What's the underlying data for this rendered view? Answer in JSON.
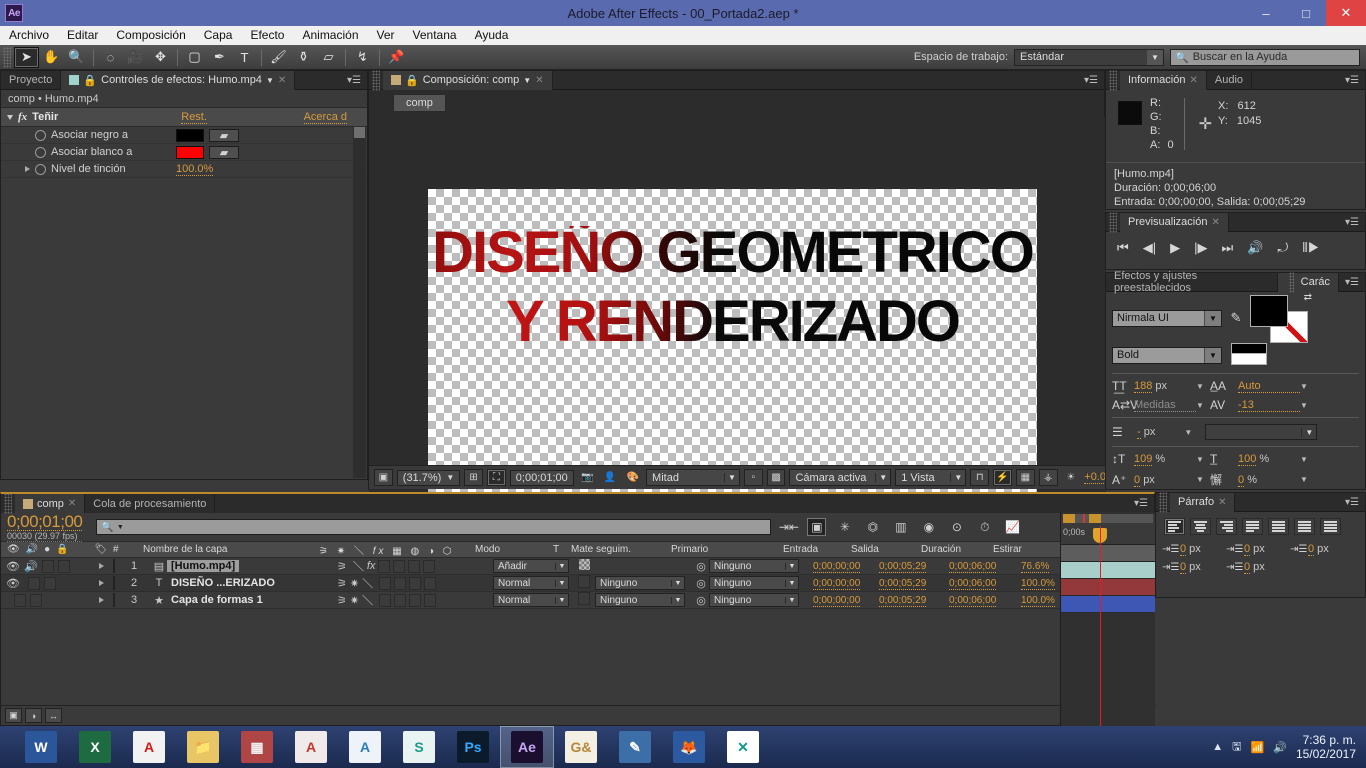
{
  "window": {
    "title": "Adobe After Effects - 00_Portada2.aep *",
    "logo": "Ae",
    "minimize": "–",
    "maximize": "□",
    "close": "✕"
  },
  "menu": [
    "Archivo",
    "Editar",
    "Composición",
    "Capa",
    "Efecto",
    "Animación",
    "Ver",
    "Ventana",
    "Ayuda"
  ],
  "toolbar": {
    "workspace_label": "Espacio de trabajo:",
    "workspace_value": "Estándar",
    "help_search_placeholder": "Buscar en la Ayuda",
    "tools": [
      {
        "name": "selection-tool",
        "glyph": "➤"
      },
      {
        "name": "hand-tool",
        "glyph": "✋"
      },
      {
        "name": "zoom-tool",
        "glyph": "🔍"
      },
      {
        "name": "rotation-tool",
        "glyph": "◌"
      },
      {
        "name": "camera-tool",
        "glyph": "🎥"
      },
      {
        "name": "pan-behind-tool",
        "glyph": "✥"
      },
      {
        "name": "shape-tool",
        "glyph": "▢"
      },
      {
        "name": "pen-tool",
        "glyph": "✒"
      },
      {
        "name": "type-tool",
        "glyph": "T"
      },
      {
        "name": "brush-tool",
        "glyph": "🖌"
      },
      {
        "name": "clone-stamp-tool",
        "glyph": "⚱"
      },
      {
        "name": "eraser-tool",
        "glyph": "▱"
      },
      {
        "name": "roto-brush-tool",
        "glyph": "↯"
      },
      {
        "name": "puppet-pin-tool",
        "glyph": "📌"
      }
    ]
  },
  "effects_panel": {
    "tab_project": "Proyecto",
    "tab_active": "Controles de efectos: Humo.mp4",
    "breadcrumb": "comp • Humo.mp4",
    "effect_name": "Teñir",
    "reset_label": "Rest.",
    "about_label": "Acerca d",
    "properties": [
      {
        "label": "Asociar negro a",
        "color": "#000000",
        "type": "color"
      },
      {
        "label": "Asociar blanco a",
        "color": "#ff0000",
        "type": "color"
      },
      {
        "label": "Nivel de tinción",
        "value": "100.0%",
        "type": "value"
      }
    ]
  },
  "composition": {
    "tab_title": "Composición: comp",
    "sub_tab": "comp",
    "text_line1": "DISEÑO GEOMETRICO",
    "text_line2": "Y RENDERIZADO",
    "toolbar": {
      "zoom": "(31.7%)",
      "timecode": "0;00;01;00",
      "resolution": "Mitad",
      "view_camera": "Cámara activa",
      "views": "1 Vista",
      "exposure": "+0.0"
    }
  },
  "info_panel": {
    "tab_info": "Información",
    "tab_audio": "Audio",
    "r_label": "R:",
    "g_label": "G:",
    "b_label": "B:",
    "a_label": "A:",
    "a_value": "0",
    "x_label": "X:",
    "x_value": "612",
    "y_label": "Y:",
    "y_value": "1045",
    "file_name": "[Humo.mp4]",
    "duration": "Duración: 0;00;06;00",
    "in_out": "Entrada: 0;00;00;00, Salida: 0;00;05;29",
    "swatch_color": "#0b0b0b"
  },
  "preview_panel": {
    "tab": "Previsualización",
    "buttons": [
      {
        "name": "go-to-start-button",
        "glyph": "⏮"
      },
      {
        "name": "previous-frame-button",
        "glyph": "◀|"
      },
      {
        "name": "play-button",
        "glyph": "▶"
      },
      {
        "name": "next-frame-button",
        "glyph": "|▶"
      },
      {
        "name": "go-to-end-button",
        "glyph": "⏭"
      },
      {
        "name": "audio-toggle-button",
        "glyph": "🔊"
      },
      {
        "name": "loop-button",
        "glyph": "⤾"
      },
      {
        "name": "ram-preview-button",
        "glyph": "⦀▶"
      }
    ]
  },
  "character_panel": {
    "tab_effects_presets": "Efectos y ajustes preestablecidos",
    "tab_character": "Carác",
    "font_family": "Nirmala UI",
    "font_style": "Bold",
    "font_size": "188",
    "font_size_unit": "px",
    "leading": "Auto",
    "kerning": "Medidas",
    "tracking": "-13",
    "stroke_width": "-",
    "stroke_width_unit": "px",
    "vertical_scale": "109",
    "vertical_scale_unit": "%",
    "horizontal_scale": "100",
    "horizontal_scale_unit": "%",
    "baseline_shift": "0",
    "baseline_shift_unit": "px",
    "tsume": "0",
    "tsume_unit": "%",
    "fill_color": "#000000",
    "stroke_color": "#ffffff"
  },
  "paragraph_panel": {
    "tab": "Párrafo",
    "indents": [
      {
        "name": "indent-left-margin",
        "value": "0",
        "unit": "px"
      },
      {
        "name": "indent-right-margin",
        "value": "0",
        "unit": "px"
      },
      {
        "name": "indent-first-line",
        "value": "0",
        "unit": "px"
      },
      {
        "name": "space-before-paragraph",
        "value": "0",
        "unit": "px"
      },
      {
        "name": "space-after-paragraph",
        "value": "0",
        "unit": "px"
      }
    ]
  },
  "timeline": {
    "tab_comp": "comp",
    "tab_render_queue": "Cola de procesamiento",
    "current_time": "0;00;01;00",
    "frame_info": "00030 (29.97 fps)",
    "search_placeholder": "",
    "ruler_start": "0;00s",
    "columns": [
      "#",
      "Nombre de la capa",
      "Modo",
      "T",
      "Mate seguim.",
      "Primario",
      "Entrada",
      "Salida",
      "Duración",
      "Estirar"
    ],
    "layers": [
      {
        "index": "1",
        "name": "[Humo.mp4]",
        "color": "#9fd3ce",
        "type_icon": "video-layer-icon",
        "mode": "Añadir",
        "track_matte": "",
        "parent": "Ninguno",
        "in": "0;00;00;00",
        "out": "0;00;05;29",
        "duration": "0;00;06;00",
        "stretch": "76.6%",
        "bar_color": "#a8cfc9",
        "has_fx": true,
        "selected": true
      },
      {
        "index": "2",
        "name": "DISEÑO ...ERIZADO",
        "color": "#b84040",
        "type_icon": "text-layer-icon",
        "mode": "Normal",
        "track_matte": "Ninguno",
        "parent": "Ninguno",
        "in": "0;00;00;00",
        "out": "0;00;05;29",
        "duration": "0;00;06;00",
        "stretch": "100.0%",
        "bar_color": "#94393b",
        "has_fx": false,
        "selected": false
      },
      {
        "index": "3",
        "name": "Capa de formas 1",
        "color": "#4f62c4",
        "type_icon": "shape-layer-icon",
        "mode": "Normal",
        "track_matte": "Ninguno",
        "parent": "Ninguno",
        "in": "0;00;00;00",
        "out": "0;00;05;29",
        "duration": "0;00;06;00",
        "stretch": "100.0%",
        "bar_color": "#3e56b4",
        "has_fx": false,
        "selected": false
      }
    ]
  },
  "taskbar": {
    "apps": [
      {
        "name": "word",
        "label": "W",
        "bg": "#2b579a",
        "fg": "#ffffff"
      },
      {
        "name": "excel",
        "label": "X",
        "bg": "#1e6b41",
        "fg": "#ffffff"
      },
      {
        "name": "acrobat-reader",
        "label": "A",
        "bg": "#f2f2f2",
        "fg": "#d01b1b"
      },
      {
        "name": "file-explorer",
        "label": "📁",
        "bg": "#e8c666",
        "fg": "#6a4b10"
      },
      {
        "name": "civil-3d",
        "label": "▦",
        "bg": "#b04545",
        "fg": "#f0f0f0"
      },
      {
        "name": "autocad",
        "label": "A",
        "bg": "#f0eaea",
        "fg": "#c0392b"
      },
      {
        "name": "autocad-c3d",
        "label": "A",
        "bg": "#edf3f8",
        "fg": "#2b7cc0"
      },
      {
        "name": "arcmap-mxd",
        "label": "S",
        "bg": "#e9f4f2",
        "fg": "#1a9a8a"
      },
      {
        "name": "photoshop",
        "label": "Ps",
        "bg": "#0c1b2c",
        "fg": "#31a8ff"
      },
      {
        "name": "after-effects",
        "label": "Ae",
        "bg": "#1a0f2e",
        "fg": "#c9a6f5",
        "active": true
      },
      {
        "name": "gandi",
        "label": "G&",
        "bg": "#f3efe2",
        "fg": "#b7863a"
      },
      {
        "name": "snipping-tool",
        "label": "✎",
        "bg": "#3c6fa8",
        "fg": "#ffffff"
      },
      {
        "name": "firefox",
        "label": "🦊",
        "bg": "#2b5aa0",
        "fg": "#ff8a27"
      },
      {
        "name": "toplink",
        "label": "✕",
        "bg": "#ffffff",
        "fg": "#0f9d8a"
      }
    ],
    "tray": [
      "▲",
      "📱",
      "📶",
      "🔊"
    ],
    "time": "7:36 p. m.",
    "date": "15/02/2017"
  }
}
